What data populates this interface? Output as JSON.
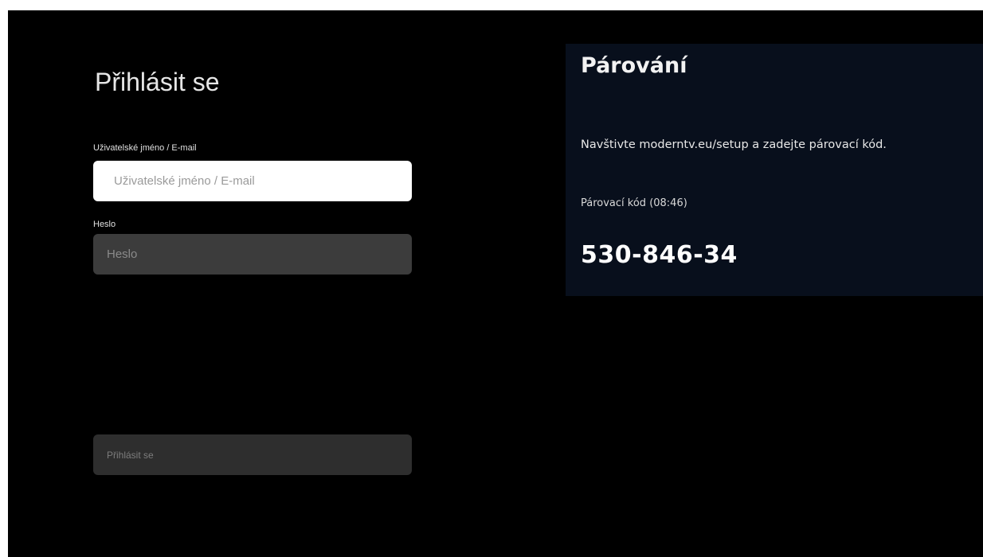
{
  "login": {
    "title": "Přihlásit se",
    "username_label": "Uživatelské jméno / E-mail",
    "username_placeholder": "Uživatelské jméno / E-mail",
    "username_value": "",
    "password_label": "Heslo",
    "password_placeholder": "Heslo",
    "password_value": "",
    "submit_label": "Přihlásit se"
  },
  "pairing": {
    "title": "Párování",
    "instructions": "Navštivte moderntv.eu/setup a zadejte párovací kód.",
    "code_label": "Párovací kód (08:46)",
    "code": "530-846-34"
  },
  "colors": {
    "background": "#000000",
    "pairing_panel": "#080f1c",
    "input_focused": "#ffffff",
    "input_idle": "#3c3c3c",
    "button_disabled": "#2e2e2e"
  }
}
